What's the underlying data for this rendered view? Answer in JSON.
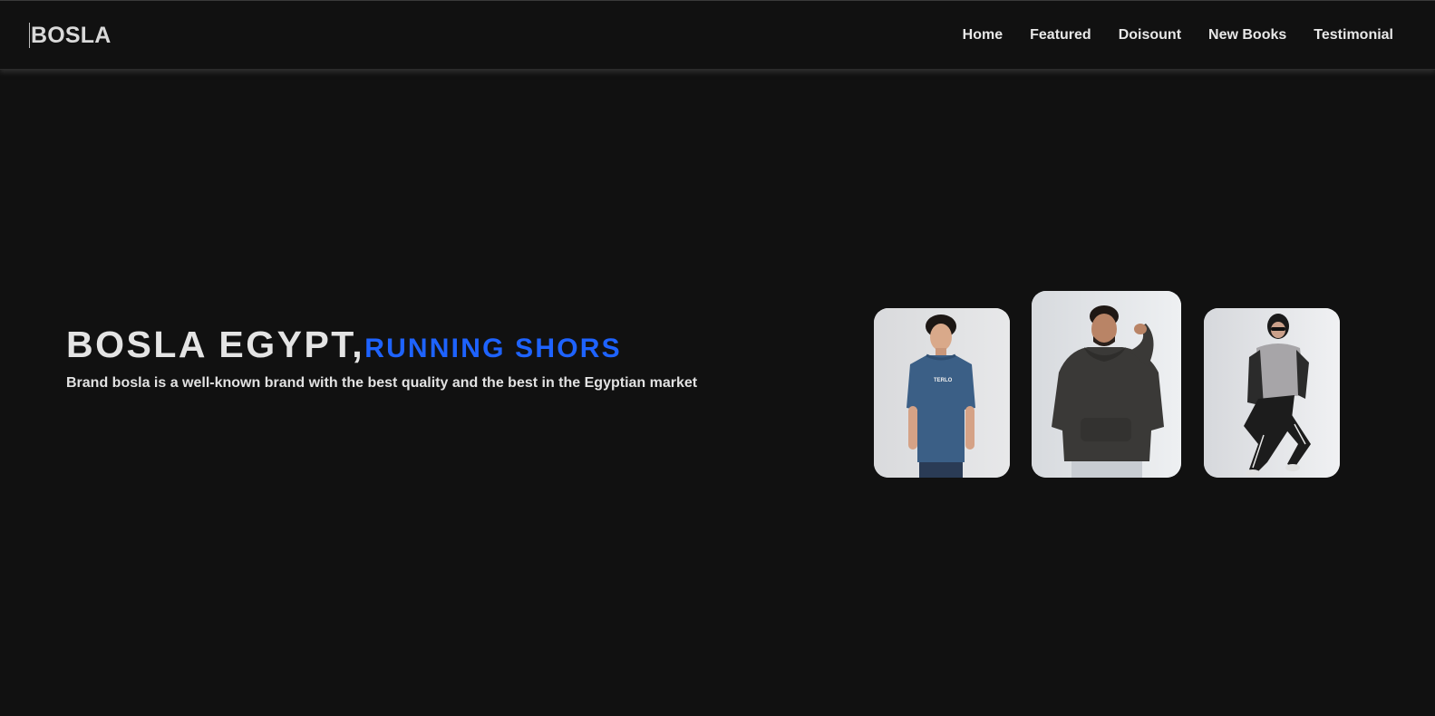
{
  "brand": {
    "logo_text": "BOSLA"
  },
  "nav": {
    "items": [
      {
        "label": "Home"
      },
      {
        "label": "Featured"
      },
      {
        "label": "Doisount"
      },
      {
        "label": "New Books"
      },
      {
        "label": "Testimonial"
      }
    ]
  },
  "hero": {
    "headline_main": "BOSLA EGYPT,",
    "headline_accent": "RUNNING SHORS",
    "tagline": "Brand bosla is a well-known brand with the best quality and the best in the Egyptian market"
  },
  "colors": {
    "background": "#111111",
    "accent": "#1e63ff",
    "text": "#e6e6e6"
  },
  "products": [
    {
      "shirt_print": "TERLO"
    }
  ]
}
